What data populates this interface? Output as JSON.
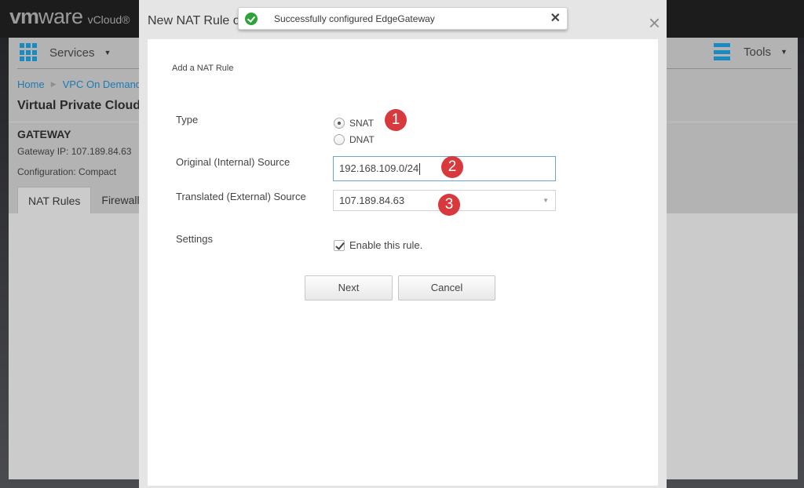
{
  "app": {
    "logo_vm": "vm",
    "logo_ware": "ware",
    "product": "vCloud®"
  },
  "nav": {
    "services_label": "Services",
    "tools_label": "Tools",
    "icon_services": "grid-icon",
    "icon_tools": "menu-icon"
  },
  "breadcrumb": [
    {
      "label": "Home"
    },
    {
      "label": "VPC On Demand"
    }
  ],
  "page": {
    "title": "Virtual Private Cloud",
    "gateway_heading": "GATEWAY",
    "gateway_ip": "Gateway IP:  107.189.84.63",
    "configuration": "Configuration:  Compact"
  },
  "bg_tabs": [
    {
      "label": "NAT Rules",
      "active": true
    },
    {
      "label": "Firewall",
      "active": false
    }
  ],
  "modal": {
    "title": "New NAT Rule on",
    "close_icon": "×",
    "section_label": "Add a NAT Rule",
    "type_label": "Type",
    "type_options": [
      {
        "label": "SNAT",
        "checked": true
      },
      {
        "label": "DNAT",
        "checked": false
      }
    ],
    "original_source_label": "Original (Internal) Source",
    "original_source_value": "192.168.109.0/24",
    "translated_source_label": "Translated (External) Source",
    "translated_source_value": "107.189.84.63",
    "settings_label": "Settings",
    "enable_rule_label": "Enable this rule.",
    "enable_rule_checked": true,
    "next_label": "Next",
    "cancel_label": "Cancel"
  },
  "annotations": [
    {
      "number": "1"
    },
    {
      "number": "2"
    },
    {
      "number": "3"
    }
  ],
  "toast": {
    "message": "Successfully configured EdgeGateway",
    "close_icon": "✕",
    "status": "success",
    "status_color": "#2ea33a"
  },
  "colors": {
    "accent_blue": "#1a8ac2",
    "link_blue": "#1f7ab1",
    "annotation_red": "#d7393c"
  }
}
